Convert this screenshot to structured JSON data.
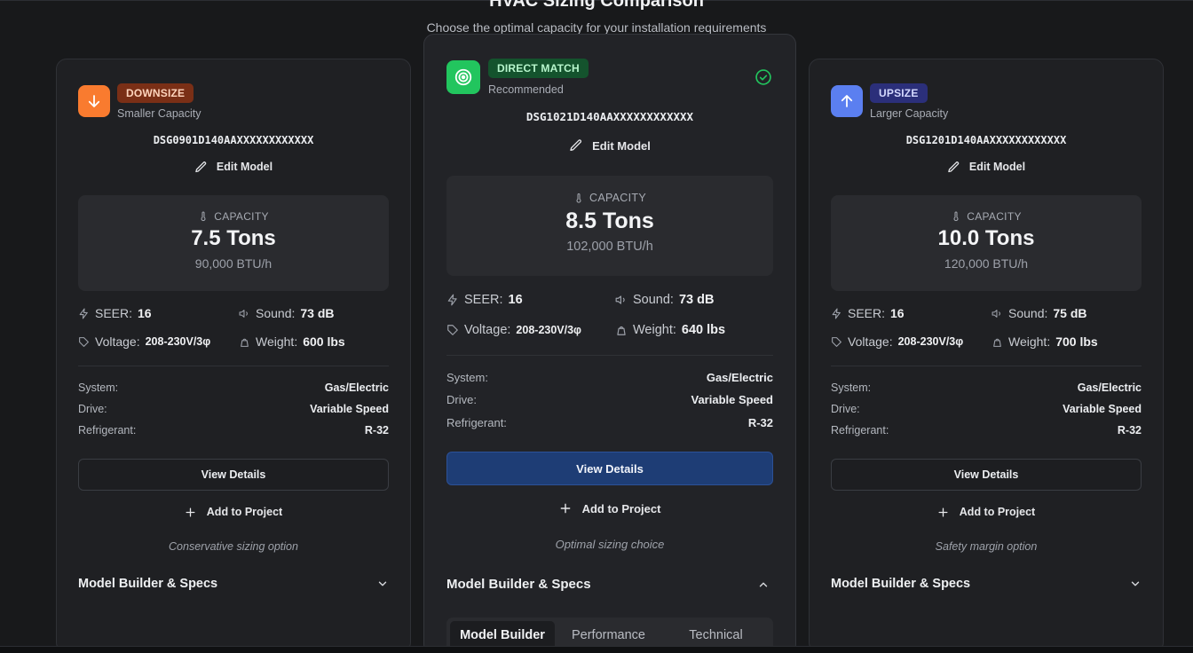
{
  "page": {
    "title": "HVAC Sizing Comparison",
    "subtitle": "Choose the optimal capacity for your installation requirements"
  },
  "colors": {
    "downsize": "#f97b2f",
    "direct_match": "#22c55e",
    "upsize": "#5b7ff0",
    "primary_button": "#1e3d75"
  },
  "cards": {
    "downsize": {
      "badge": "DOWNSIZE",
      "subtitle": "Smaller Capacity",
      "icon": "arrow-down-icon",
      "model": "DSG0901D140AAXXXXXXXXXXXX",
      "edit_label": "Edit Model",
      "capacity_label": "CAPACITY",
      "capacity": "7.5 Tons",
      "btu": "90,000 BTU/h",
      "seer_label": "SEER:",
      "seer": "16",
      "sound_label": "Sound:",
      "sound": "73 dB",
      "voltage_label": "Voltage:",
      "voltage": "208-230V/3φ",
      "weight_label": "Weight:",
      "weight": "600 lbs",
      "system_label": "System:",
      "system": "Gas/Electric",
      "drive_label": "Drive:",
      "drive": "Variable Speed",
      "refrigerant_label": "Refrigerant:",
      "refrigerant": "R-32",
      "details_label": "View Details",
      "add_label": "Add to Project",
      "note": "Conservative sizing option",
      "builder_label": "Model Builder & Specs"
    },
    "direct": {
      "badge": "DIRECT MATCH",
      "subtitle": "Recommended",
      "icon": "target-icon",
      "model": "DSG1021D140AAXXXXXXXXXXXX",
      "edit_label": "Edit Model",
      "capacity_label": "CAPACITY",
      "capacity": "8.5 Tons",
      "btu": "102,000 BTU/h",
      "seer_label": "SEER:",
      "seer": "16",
      "sound_label": "Sound:",
      "sound": "73 dB",
      "voltage_label": "Voltage:",
      "voltage": "208-230V/3φ",
      "weight_label": "Weight:",
      "weight": "640 lbs",
      "system_label": "System:",
      "system": "Gas/Electric",
      "drive_label": "Drive:",
      "drive": "Variable Speed",
      "refrigerant_label": "Refrigerant:",
      "refrigerant": "R-32",
      "details_label": "View Details",
      "add_label": "Add to Project",
      "note": "Optimal sizing choice",
      "builder_label": "Model Builder & Specs",
      "tabs": [
        "Model Builder",
        "Performance",
        "Technical"
      ],
      "active_tab": "Model Builder"
    },
    "upsize": {
      "badge": "UPSIZE",
      "subtitle": "Larger Capacity",
      "icon": "arrow-up-icon",
      "model": "DSG1201D140AAXXXXXXXXXXXX",
      "edit_label": "Edit Model",
      "capacity_label": "CAPACITY",
      "capacity": "10.0 Tons",
      "btu": "120,000 BTU/h",
      "seer_label": "SEER:",
      "seer": "16",
      "sound_label": "Sound:",
      "sound": "75 dB",
      "voltage_label": "Voltage:",
      "voltage": "208-230V/3φ",
      "weight_label": "Weight:",
      "weight": "700 lbs",
      "system_label": "System:",
      "system": "Gas/Electric",
      "drive_label": "Drive:",
      "drive": "Variable Speed",
      "refrigerant_label": "Refrigerant:",
      "refrigerant": "R-32",
      "details_label": "View Details",
      "add_label": "Add to Project",
      "note": "Safety margin option",
      "builder_label": "Model Builder & Specs"
    }
  }
}
